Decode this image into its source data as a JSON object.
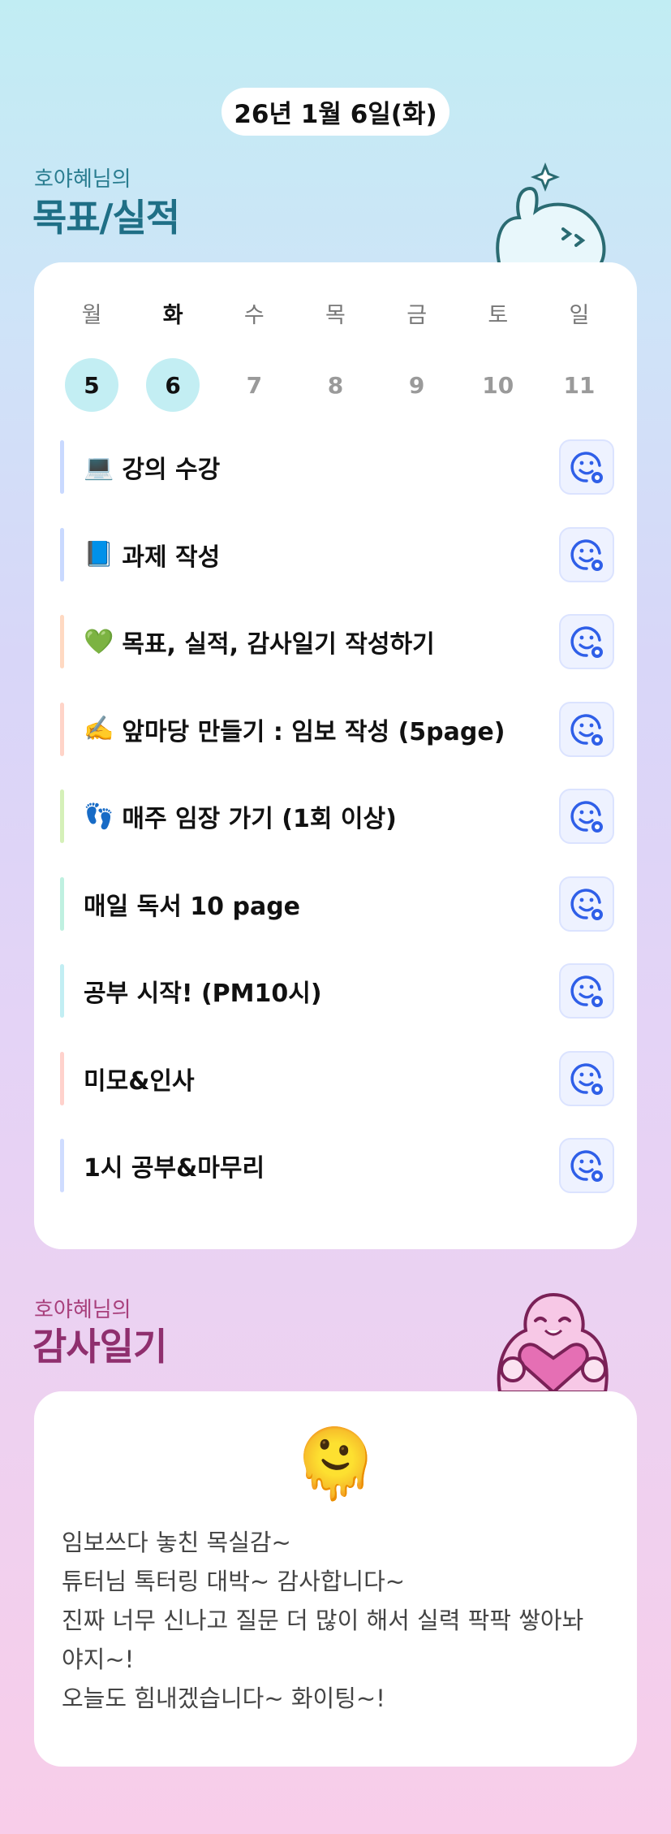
{
  "date_label": "26년 1월 6일(화)",
  "goals_section": {
    "owner": "호야혜님의",
    "title": "목표/실적",
    "title_color": "#1f6f86"
  },
  "week": {
    "days": [
      "월",
      "화",
      "수",
      "목",
      "금",
      "토",
      "일"
    ],
    "dates": [
      "5",
      "6",
      "7",
      "8",
      "9",
      "10",
      "11"
    ],
    "today_index": 1,
    "completed_indices": [
      0,
      1
    ]
  },
  "goals": [
    {
      "emoji": "💻",
      "text": "강의 수강",
      "bar_color": "#c9d9ff",
      "react_icon": "smile-add-icon"
    },
    {
      "emoji": "📘",
      "text": "과제 작성",
      "bar_color": "#c9d9ff",
      "react_icon": "smile-add-icon"
    },
    {
      "emoji": "💚",
      "text": "목표, 실적, 감사일기 작성하기",
      "bar_color": "#ffd9c2",
      "react_icon": "smile-add-icon"
    },
    {
      "emoji": "✍️",
      "text": "앞마당 만들기 : 임보 작성 (5page)",
      "bar_color": "#ffd4c8",
      "react_icon": "smile-add-icon"
    },
    {
      "emoji": "👣",
      "text": "매주 임장 가기 (1회 이상)",
      "bar_color": "#d5f0b8",
      "react_icon": "smile-add-icon"
    },
    {
      "emoji": "",
      "text": "매일 독서 10 page",
      "bar_color": "#bff0e0",
      "react_icon": "smile-add-icon"
    },
    {
      "emoji": "",
      "text": "공부 시작! (PM10시)",
      "bar_color": "#c2eef3",
      "react_icon": "smile-add-icon"
    },
    {
      "emoji": "",
      "text": "미모&인사",
      "bar_color": "#ffd2cc",
      "react_icon": "smile-add-icon"
    },
    {
      "emoji": "",
      "text": "1시 공부&마무리",
      "bar_color": "#cfdcff",
      "react_icon": "smile-add-icon"
    }
  ],
  "diary_section": {
    "owner": "호야혜님의",
    "title": "감사일기",
    "title_color": "#8f2f6e"
  },
  "diary": {
    "emoji": "🫠",
    "lines": [
      "임보쓰다 놓친 목실감~",
      "튜터님 톡터링 대박~ 감사합니다~",
      "진짜 너무 신나고 질문 더 많이 해서 실력 팍팍 쌓아놔",
      "야지~!",
      "오늘도 힘내겠습니다~ 화이팅~!"
    ]
  },
  "colors": {
    "accent_blue": "#2f5fe8",
    "today_circle": "#c3eef3"
  }
}
